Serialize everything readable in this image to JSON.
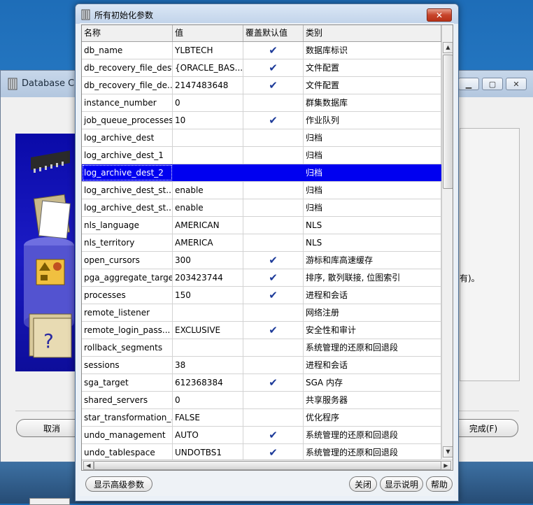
{
  "background_window": {
    "title": "Database Co",
    "cancel_label": "取消",
    "finish_label": "完成(F)",
    "partial_text": "有)。"
  },
  "dialog": {
    "title": "所有初始化参数",
    "close_glyph": "✕",
    "columns": [
      "名称",
      "值",
      "覆盖默认值",
      "类别"
    ],
    "check_glyph": "✔",
    "rows": [
      {
        "name": "db_name",
        "value": "YLBTECH",
        "override": true,
        "category": "数据库标识"
      },
      {
        "name": "db_recovery_file_dest",
        "value": "{ORACLE_BAS...",
        "override": true,
        "category": "文件配置"
      },
      {
        "name": "db_recovery_file_de...",
        "value": "2147483648",
        "override": true,
        "category": "文件配置"
      },
      {
        "name": "instance_number",
        "value": "0",
        "override": false,
        "category": "群集数据库"
      },
      {
        "name": "job_queue_processes",
        "value": "10",
        "override": true,
        "category": "作业队列"
      },
      {
        "name": "log_archive_dest",
        "value": "",
        "override": false,
        "category": "归档"
      },
      {
        "name": "log_archive_dest_1",
        "value": "",
        "override": false,
        "category": "归档"
      },
      {
        "name": "log_archive_dest_2",
        "value": "",
        "override": false,
        "category": "归档",
        "selected": true
      },
      {
        "name": "log_archive_dest_st...",
        "value": "enable",
        "override": false,
        "category": "归档"
      },
      {
        "name": "log_archive_dest_st...",
        "value": "enable",
        "override": false,
        "category": "归档"
      },
      {
        "name": "nls_language",
        "value": "AMERICAN",
        "override": false,
        "category": "NLS"
      },
      {
        "name": "nls_territory",
        "value": "AMERICA",
        "override": false,
        "category": "NLS"
      },
      {
        "name": "open_cursors",
        "value": "300",
        "override": true,
        "category": "游标和库高速缓存"
      },
      {
        "name": "pga_aggregate_target",
        "value": "203423744",
        "override": true,
        "category": "排序, 散列联接, 位图索引"
      },
      {
        "name": "processes",
        "value": "150",
        "override": true,
        "category": "进程和会话"
      },
      {
        "name": "remote_listener",
        "value": "",
        "override": false,
        "category": "网络注册"
      },
      {
        "name": "remote_login_pass...",
        "value": "EXCLUSIVE",
        "override": true,
        "category": "安全性和审计"
      },
      {
        "name": "rollback_segments",
        "value": "",
        "override": false,
        "category": "系统管理的还原和回退段"
      },
      {
        "name": "sessions",
        "value": "38",
        "override": false,
        "category": "进程和会话"
      },
      {
        "name": "sga_target",
        "value": "612368384",
        "override": true,
        "category": "SGA 内存"
      },
      {
        "name": "shared_servers",
        "value": "0",
        "override": false,
        "category": "共享服务器"
      },
      {
        "name": "star_transformation_...",
        "value": "FALSE",
        "override": false,
        "category": "优化程序"
      },
      {
        "name": "undo_management",
        "value": "AUTO",
        "override": true,
        "category": "系统管理的还原和回退段"
      },
      {
        "name": "undo_tablespace",
        "value": "UNDOTBS1",
        "override": true,
        "category": "系统管理的还原和回退段"
      }
    ],
    "buttons": {
      "show_advanced": "显示高级参数",
      "close": "关闭",
      "show_description": "显示说明",
      "help": "帮助"
    }
  },
  "colors": {
    "selection": "#0000f0",
    "checkmark": "#1c3a99",
    "close_button": "#c7442b"
  }
}
